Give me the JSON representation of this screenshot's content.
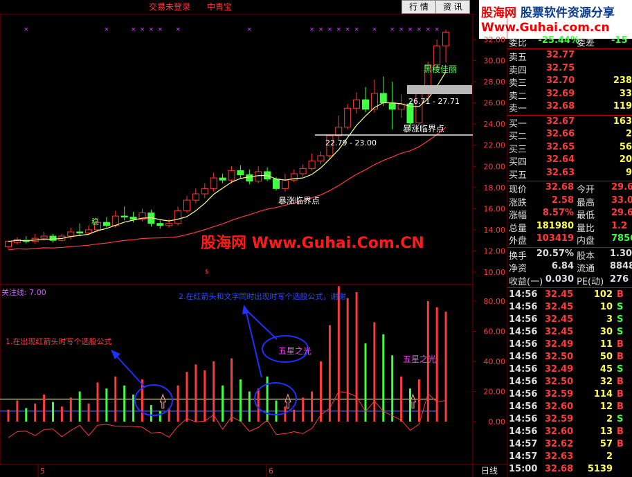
{
  "topbar": {
    "title": "交易未登录　　中青宝",
    "tab_hq": "行 情",
    "tab_zx": "资 讯",
    "logo_main_a": "股海网",
    "logo_main_b": " 股票软件资源分享",
    "logo_url": "Www.Guhai.com.cn"
  },
  "colors": {
    "up": "#ff3a3a",
    "down": "#40ff40",
    "ma_white": "#ffff90",
    "ma_red": "#ff3a3a",
    "grid": "#800000"
  },
  "chart_data": {
    "type": "candlestick",
    "price_axis_ticks": [
      10.0,
      12.0,
      14.0,
      16.0,
      18.0,
      20.0,
      22.0,
      24.0,
      26.0,
      28.0,
      30.0,
      32.0
    ],
    "indicator_axis_ticks": [
      0.0,
      20.0,
      40.0,
      60.0,
      80.0
    ],
    "x_labels": [
      "5",
      "6"
    ],
    "candles": [
      [
        12.4,
        12.9,
        12.2,
        13.0
      ],
      [
        12.8,
        13.1,
        12.6,
        13.3
      ],
      [
        13.0,
        12.9,
        12.7,
        13.4
      ],
      [
        12.9,
        13.2,
        12.7,
        13.6
      ],
      [
        13.2,
        13.4,
        13.0,
        13.8
      ],
      [
        13.4,
        13.0,
        12.8,
        13.6
      ],
      [
        13.0,
        13.4,
        12.9,
        13.6
      ],
      [
        13.4,
        13.8,
        13.1,
        14.2
      ],
      [
        13.8,
        13.7,
        13.5,
        14.6
      ],
      [
        13.7,
        14.0,
        13.5,
        14.4
      ],
      [
        14.0,
        14.7,
        13.8,
        15.0
      ],
      [
        14.7,
        14.4,
        14.2,
        15.2
      ],
      [
        14.4,
        15.3,
        14.2,
        15.8
      ],
      [
        15.3,
        15.2,
        14.9,
        16.2
      ],
      [
        15.2,
        15.0,
        14.7,
        15.7
      ],
      [
        15.0,
        15.6,
        14.8,
        16.0
      ],
      [
        15.6,
        14.6,
        14.3,
        15.9
      ],
      [
        14.6,
        14.4,
        14.1,
        14.9
      ],
      [
        14.4,
        14.6,
        14.2,
        15.0
      ],
      [
        14.6,
        15.8,
        14.4,
        16.2
      ],
      [
        15.8,
        16.8,
        15.6,
        17.2
      ],
      [
        16.8,
        17.4,
        16.5,
        17.9
      ],
      [
        17.4,
        17.9,
        17.0,
        18.4
      ],
      [
        17.9,
        18.9,
        17.6,
        19.4
      ],
      [
        18.9,
        18.7,
        18.4,
        19.3
      ],
      [
        18.7,
        19.6,
        18.4,
        20.0
      ],
      [
        19.6,
        19.2,
        18.9,
        20.1
      ],
      [
        19.2,
        18.6,
        18.3,
        19.7
      ],
      [
        18.6,
        19.5,
        18.4,
        20.0
      ],
      [
        19.5,
        18.8,
        18.6,
        19.9
      ],
      [
        18.8,
        17.9,
        17.7,
        19.0
      ],
      [
        17.9,
        18.7,
        17.6,
        19.3
      ],
      [
        18.7,
        19.3,
        18.5,
        19.7
      ],
      [
        19.3,
        19.8,
        19.0,
        20.2
      ],
      [
        19.8,
        20.5,
        19.6,
        21.2
      ],
      [
        20.5,
        21.0,
        20.2,
        21.4
      ],
      [
        21.0,
        22.9,
        20.8,
        23.0
      ],
      [
        22.9,
        23.7,
        22.5,
        24.8
      ],
      [
        23.7,
        25.5,
        23.5,
        25.9
      ],
      [
        25.5,
        26.3,
        25.0,
        27.0
      ],
      [
        26.3,
        25.4,
        25.1,
        27.5
      ],
      [
        25.4,
        26.9,
        25.1,
        28.2
      ],
      [
        26.9,
        26.0,
        25.7,
        28.5
      ],
      [
        26.0,
        25.4,
        23.5,
        28.0
      ],
      [
        25.4,
        25.9,
        24.6,
        26.8
      ],
      [
        25.9,
        24.1,
        23.4,
        26.2
      ],
      [
        24.1,
        26.9,
        23.9,
        27.0
      ],
      [
        26.9,
        29.6,
        26.5,
        29.9
      ],
      [
        29.6,
        31.4,
        29.3,
        32.0
      ],
      [
        31.4,
        32.7,
        29.8,
        32.9
      ]
    ],
    "volume_bars": [
      8,
      14,
      9,
      12,
      18,
      13,
      10,
      16,
      20,
      12,
      26,
      22,
      30,
      24,
      18,
      28,
      11,
      7,
      9,
      24,
      33,
      38,
      34,
      40,
      24,
      42,
      28,
      20,
      22,
      30,
      14,
      10,
      8,
      16,
      20,
      40,
      64,
      90,
      82,
      86,
      52,
      66,
      58,
      44,
      30,
      22,
      28,
      80,
      76,
      73
    ]
  },
  "annotations": {
    "watermark": "股海网 Www.Guhai.Com.CN",
    "ann1": "1.在出现红箭头时写个选股公式",
    "ann2": "2.在红箭头和文字同时出现时写个选股公式，谢谢",
    "indicator_label": "关注线: 7.00",
    "wuxing1": "五星之光",
    "wuxing2": "五星之光",
    "heiqi": "黑稜佳丽",
    "baozhang1": "暴涨临界点",
    "baozhang2": "暴涨临界点",
    "range1": "26.71 - 27.71",
    "range2": "22.79 - 23.00",
    "zhu": "稳",
    "day_label": "日线"
  },
  "quote": {
    "webi_label": "委比",
    "webi_val": "-25.44%",
    "weicha_label": "委差",
    "weicha_val": "-15",
    "asks": [
      {
        "label": "卖五",
        "price": "32.77",
        "vol": ""
      },
      {
        "label": "卖四",
        "price": "32.75",
        "vol": ""
      },
      {
        "label": "卖三",
        "price": "32.70",
        "vol": "238"
      },
      {
        "label": "卖二",
        "price": "32.69",
        "vol": "33"
      },
      {
        "label": "卖一",
        "price": "32.68",
        "vol": "119"
      }
    ],
    "bids": [
      {
        "label": "买一",
        "price": "32.67",
        "vol": "163"
      },
      {
        "label": "买二",
        "price": "32.66",
        "vol": "2"
      },
      {
        "label": "买三",
        "price": "32.65",
        "vol": "56"
      },
      {
        "label": "买四",
        "price": "32.64",
        "vol": "20"
      },
      {
        "label": "买五",
        "price": "32.63",
        "vol": "9"
      }
    ],
    "stats": [
      {
        "l1": "现价",
        "v1": "32.68",
        "c1": "#ff3a3a",
        "l2": "今开",
        "v2": "29.6",
        "c2": "#ff3a3a"
      },
      {
        "l1": "涨跌",
        "v1": "2.58",
        "c1": "#ff3a3a",
        "l2": "最高",
        "v2": "33.0",
        "c2": "#ff3a3a"
      },
      {
        "l1": "涨幅",
        "v1": "8.57%",
        "c1": "#ff3a3a",
        "l2": "最低",
        "v2": "29.6",
        "c2": "#ff3a3a"
      },
      {
        "l1": "总量",
        "v1": "181980",
        "c1": "#ffff50",
        "l2": "量比",
        "v2": "1.2",
        "c2": "#ff3a3a"
      },
      {
        "l1": "外盘",
        "v1": "103419",
        "c1": "#ff3a3a",
        "l2": "内盘",
        "v2": "7856",
        "c2": "#40ff40"
      }
    ],
    "stats2": [
      {
        "l1": "换手",
        "v1": "20.57%",
        "c1": "#ddd",
        "l2": "股本",
        "v2": "1.30",
        "c2": "#ddd"
      },
      {
        "l1": "净资",
        "v1": "6.84",
        "c1": "#ddd",
        "l2": "流通",
        "v2": "8848",
        "c2": "#ddd"
      },
      {
        "l1": "收益(一)",
        "v1": "0.030",
        "c1": "#ddd",
        "l2": "PE(动)",
        "v2": "276",
        "c2": "#ddd"
      }
    ],
    "ticks": [
      {
        "t": "14:56",
        "p": "32.45",
        "v": "102",
        "bs": "B"
      },
      {
        "t": "14:56",
        "p": "32.45",
        "v": "10",
        "bs": "S"
      },
      {
        "t": "14:56",
        "p": "32.45",
        "v": "3",
        "bs": "S"
      },
      {
        "t": "14:56",
        "p": "32.45",
        "v": "30",
        "bs": "S"
      },
      {
        "t": "14:56",
        "p": "32.49",
        "v": "11",
        "bs": "B"
      },
      {
        "t": "14:56",
        "p": "32.50",
        "v": "50",
        "bs": "B"
      },
      {
        "t": "14:56",
        "p": "32.49",
        "v": "45",
        "bs": "S"
      },
      {
        "t": "14:56",
        "p": "32.50",
        "v": "32",
        "bs": "B"
      },
      {
        "t": "14:56",
        "p": "32.59",
        "v": "114",
        "bs": "B"
      },
      {
        "t": "14:56",
        "p": "32.60",
        "v": "12",
        "bs": "B"
      },
      {
        "t": "14:56",
        "p": "32.59",
        "v": "2",
        "bs": "S"
      },
      {
        "t": "14:56",
        "p": "32.60",
        "v": "13",
        "bs": "B"
      },
      {
        "t": "14:57",
        "p": "32.62",
        "v": "57",
        "bs": "B"
      },
      {
        "t": "14:57",
        "p": "32.63",
        "v": "2",
        "bs": ""
      },
      {
        "t": "15:00",
        "p": "32.68",
        "v": "5139",
        "bs": ""
      }
    ]
  }
}
